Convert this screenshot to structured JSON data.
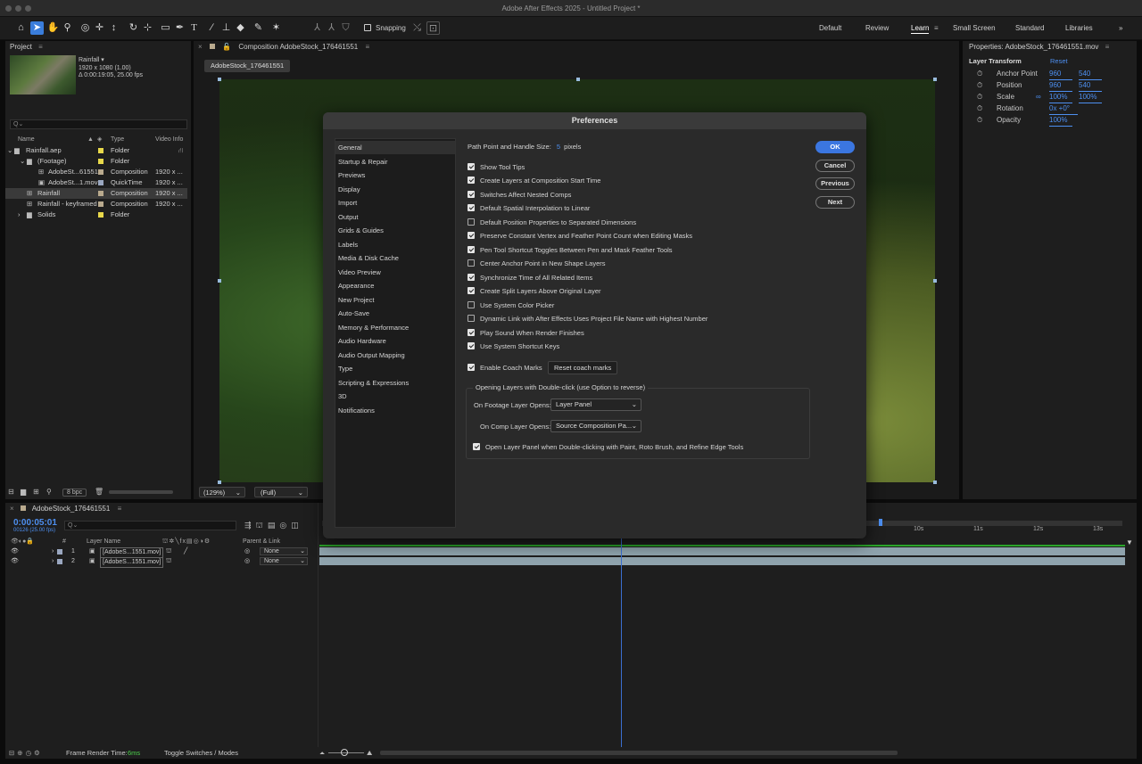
{
  "window": {
    "title": "Adobe After Effects 2025 - Untitled Project *"
  },
  "toolbar": {
    "snapping": "Snapping",
    "workspaces": [
      "Default",
      "Review",
      "Learn",
      "Small Screen",
      "Standard",
      "Libraries"
    ],
    "more": "»"
  },
  "project": {
    "panel_title": "Project",
    "menu": "≡",
    "comp_name": "Rainfall ▾",
    "comp_res": "1920 x 1080 (1.00)",
    "comp_dur": "Δ 0:00:19:05, 25.00 fps",
    "search_placeholder": "Q⌄",
    "cols": {
      "name": "Name",
      "type": "Type",
      "info": "Video Info"
    },
    "rows": [
      {
        "name": "Rainfall.aep",
        "type": "Folder",
        "info": "",
        "color": "#e8d84a"
      },
      {
        "name": "(Footage)",
        "type": "Folder",
        "info": "",
        "color": "#e8d84a"
      },
      {
        "name": "AdobeSt...61551",
        "type": "Composition",
        "info": "1920 x ...",
        "color": "#b9aa8e"
      },
      {
        "name": "AdobeSt...1.mov",
        "type": "QuickTime",
        "info": "1920 x ...",
        "color": "#9aa7c0"
      },
      {
        "name": "Rainfall",
        "type": "Composition",
        "info": "1920 x ...",
        "color": "#b9aa8e"
      },
      {
        "name": "Rainfall - keyframed",
        "type": "Composition",
        "info": "1920 x ...",
        "color": "#b9aa8e"
      },
      {
        "name": "Solids",
        "type": "Folder",
        "info": "",
        "color": "#e8d84a"
      }
    ],
    "bpc": "8 bpc"
  },
  "composition": {
    "tab": "Composition AdobeStock_176461551",
    "chip": "AdobeStock_176461551",
    "zoom": "(129%)",
    "quality": "(Full)"
  },
  "properties": {
    "title": "Properties: AdobeStock_176461551.mov",
    "section": "Layer Transform",
    "reset": "Reset",
    "rows": [
      {
        "label": "Anchor Point",
        "v1": "960",
        "v2": "540"
      },
      {
        "label": "Position",
        "v1": "960",
        "v2": "540"
      },
      {
        "label": "Scale",
        "v1": "100%",
        "v2": "100%"
      },
      {
        "label": "Rotation",
        "v1": "0x +0°",
        "v2": ""
      },
      {
        "label": "Opacity",
        "v1": "100%",
        "v2": ""
      }
    ]
  },
  "prefs": {
    "title": "Preferences",
    "categories": [
      "General",
      "Startup & Repair",
      "Previews",
      "Display",
      "Import",
      "Output",
      "Grids & Guides",
      "Labels",
      "Media & Disk Cache",
      "Video Preview",
      "Appearance",
      "New Project",
      "Auto-Save",
      "Memory & Performance",
      "Audio Hardware",
      "Audio Output Mapping",
      "Type",
      "Scripting & Expressions",
      "3D",
      "Notifications"
    ],
    "path_label": "Path Point and Handle Size:",
    "path_value": "5",
    "path_unit": "pixels",
    "options": [
      {
        "label": "Show Tool Tips",
        "on": true
      },
      {
        "label": "Create Layers at Composition Start Time",
        "on": true
      },
      {
        "label": "Switches Affect Nested Comps",
        "on": true
      },
      {
        "label": "Default Spatial Interpolation to Linear",
        "on": true
      },
      {
        "label": "Default Position Properties to Separated Dimensions",
        "on": false
      },
      {
        "label": "Preserve Constant Vertex and Feather Point Count when Editing Masks",
        "on": true
      },
      {
        "label": "Pen Tool Shortcut Toggles Between Pen and Mask Feather Tools",
        "on": true
      },
      {
        "label": "Center Anchor Point in New Shape Layers",
        "on": false
      },
      {
        "label": "Synchronize Time of All Related Items",
        "on": true
      },
      {
        "label": "Create Split Layers Above Original Layer",
        "on": true
      },
      {
        "label": "Use System Color Picker",
        "on": false
      },
      {
        "label": "Dynamic Link with After Effects Uses Project File Name with Highest Number",
        "on": false
      },
      {
        "label": "Play Sound When Render Finishes",
        "on": true
      },
      {
        "label": "Use System Shortcut Keys",
        "on": true
      }
    ],
    "coach": "Enable Coach Marks",
    "reset_coach": "Reset coach marks",
    "group_title": "Opening Layers with Double-click (use Option to reverse)",
    "footage_label": "On Footage Layer Opens:",
    "footage_value": "Layer Panel",
    "comp_label": "On Comp Layer Opens:",
    "comp_value": "Source Composition Pa...",
    "open_layer": "Open Layer Panel when Double-clicking with Paint, Roto Brush, and Refine Edge Tools",
    "buttons": {
      "ok": "OK",
      "cancel": "Cancel",
      "previous": "Previous",
      "next": "Next"
    }
  },
  "timeline": {
    "tab": "AdobeStock_176461551",
    "time": "0:00:05:01",
    "frames": "00126 (25.00 fps)",
    "search_placeholder": "Q⌄",
    "cols": {
      "num": "#",
      "layer": "Layer Name",
      "parent": "Parent & Link"
    },
    "layers": [
      {
        "num": "1",
        "name": "[AdobeS...1551.mov]",
        "parent": "None"
      },
      {
        "num": "2",
        "name": "[AdobeS...1551.mov]",
        "parent": "None"
      }
    ],
    "ruler": [
      "10s",
      "11s",
      "12s",
      "13s"
    ],
    "render_label": "Frame Render Time:",
    "render_value": "6ms",
    "toggle": "Toggle Switches / Modes"
  }
}
